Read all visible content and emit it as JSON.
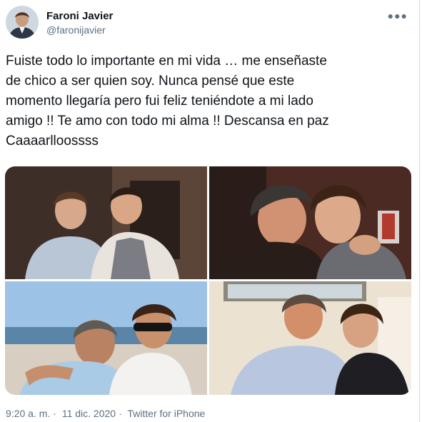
{
  "author": {
    "display_name": "Faroni Javier",
    "handle": "@faronijavier"
  },
  "tweet": {
    "text": "Fuiste todo lo importante en mi vida … me enseñaste\nde chico a ser quien soy. Nunca pensé que este\nmomento llegaría pero fui feliz teniéndote a mi lado\namigo !! Te amo con todo mi alma !! Descansa en paz\nCaaaarlloossss"
  },
  "meta": {
    "time": "9:20 a. m.",
    "separator_1": "·",
    "date": "11 dic. 2020",
    "separator_2": "·",
    "source": "Twitter for iPhone"
  },
  "icons": {
    "more": "more-options-icon",
    "avatar": "profile-avatar"
  },
  "colors": {
    "text": "#0f1419",
    "secondary": "#5b7083"
  }
}
